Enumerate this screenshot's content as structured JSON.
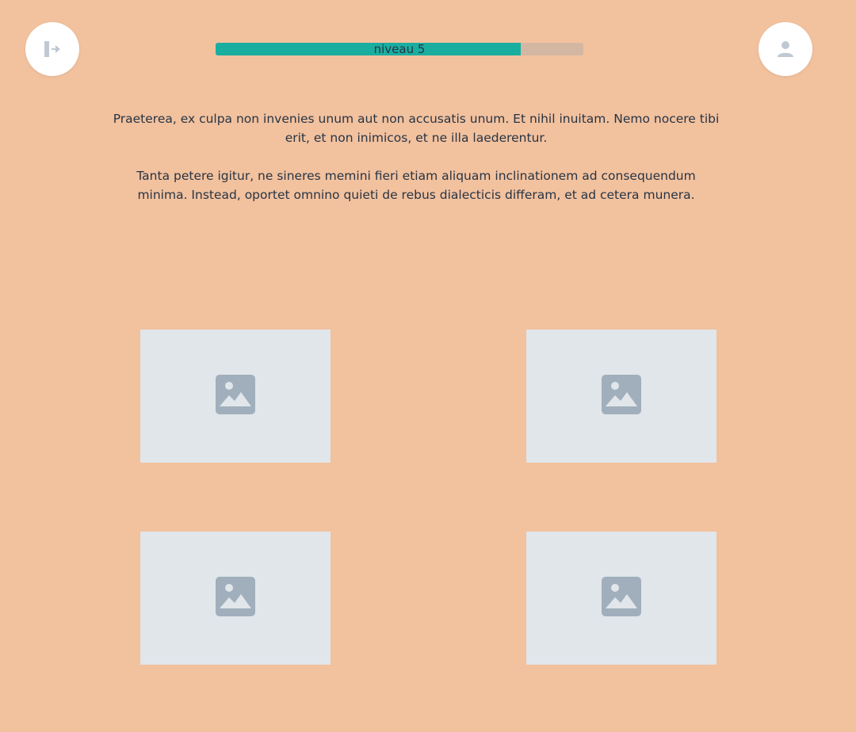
{
  "header": {
    "exit_icon": "exit-icon",
    "profile_icon": "user-icon",
    "progress": {
      "label": "niveau 5",
      "fraction": 0.83,
      "fill_color": "#1aaea0",
      "track_color": "#d4b7a3"
    }
  },
  "content": {
    "paragraphs": [
      "Praeterea, ex culpa non invenies unum aut non accusatis unum. Et nihil inuitam. Nemo nocere tibi erit, et non inimicos, et ne illa laederentur.",
      "Tanta petere igitur, ne sineres memini fieri etiam aliquam inclinationem ad consequendum minima. Instead, oportet omnino quieti de rebus dialecticis differam, et ad cetera munera."
    ]
  },
  "choices": [
    {
      "icon": "image-placeholder-icon"
    },
    {
      "icon": "image-placeholder-icon"
    },
    {
      "icon": "image-placeholder-icon"
    },
    {
      "icon": "image-placeholder-icon"
    }
  ],
  "colors": {
    "background": "#f2c19e",
    "placeholder_bg": "#e1e6eb",
    "placeholder_icon": "#a0afbb",
    "text": "#273444"
  }
}
